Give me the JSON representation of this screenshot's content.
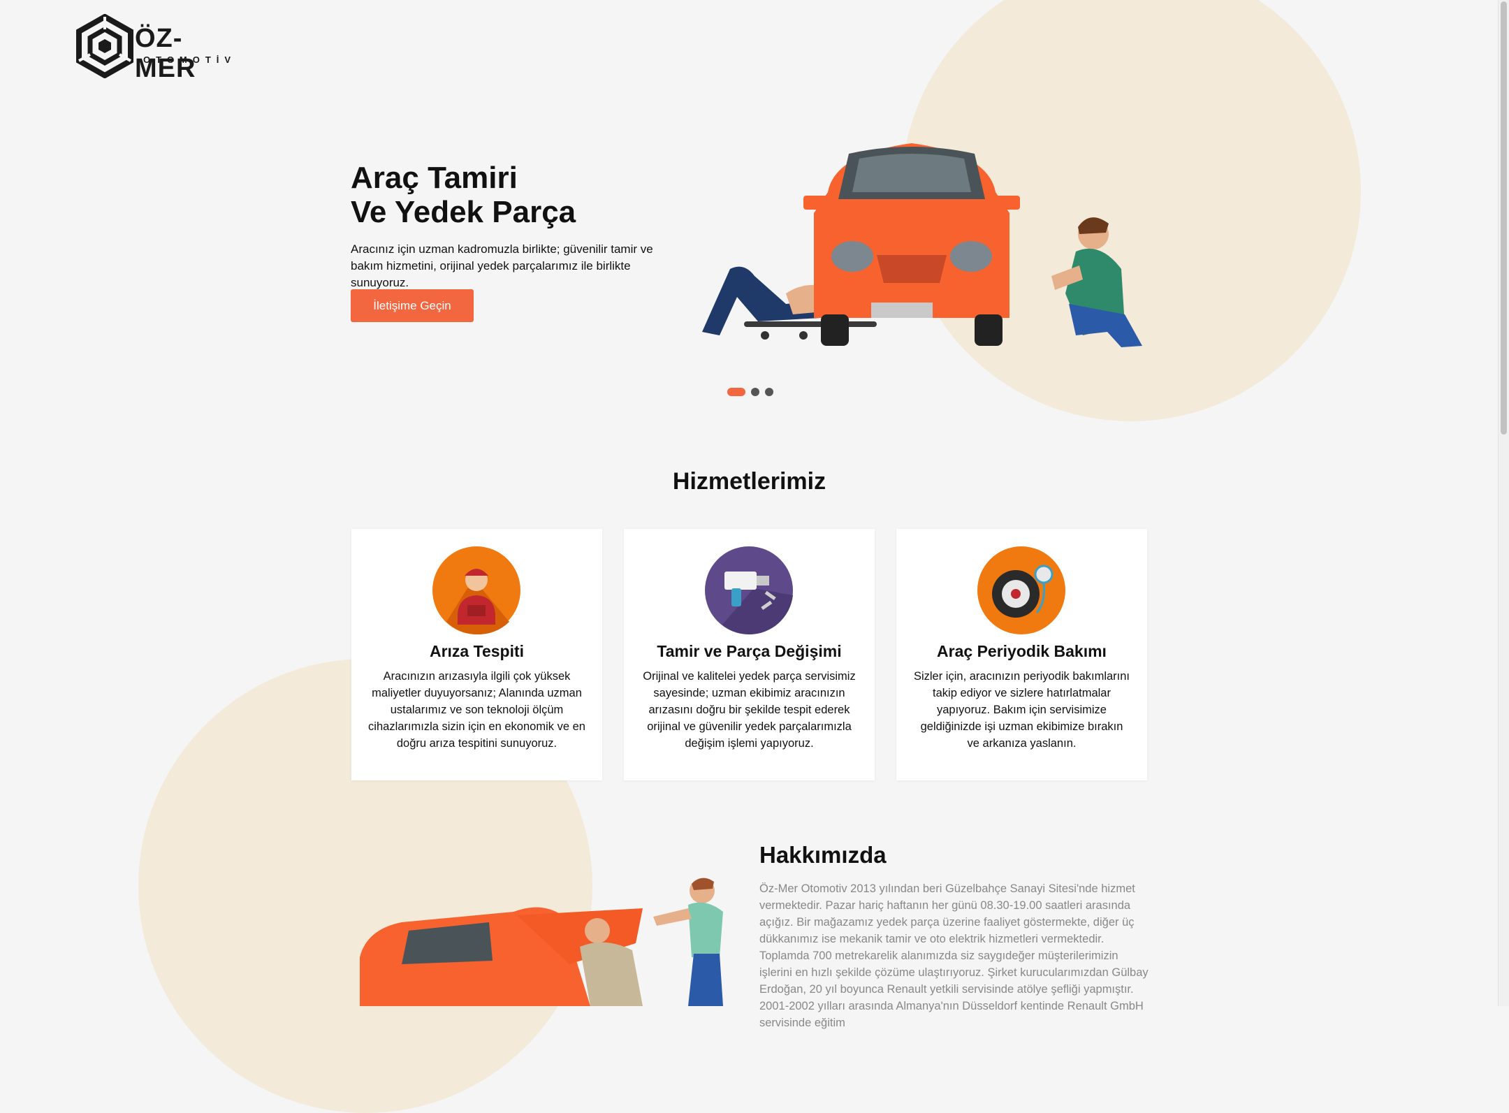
{
  "colors": {
    "accent": "#f26640",
    "blob": "#f3ead9",
    "background": "#f5f5f5"
  },
  "logo": {
    "name": "ÖZ-MER",
    "subtitle": "OTOMOTİV"
  },
  "hero": {
    "title_line1": "Araç Tamiri",
    "title_line2": "Ve Yedek Parça",
    "description": "Aracınız için uzman kadromuzla birlikte; güvenilir tamir ve bakım hizmetini, orijinal yedek parçalarımız ile birlikte sunuyoruz.",
    "cta_label": "İletişime Geçin"
  },
  "slider": {
    "slide_count": 3,
    "active_index": 1
  },
  "services": {
    "title": "Hizmetlerimiz",
    "items": [
      {
        "icon": "mechanic-icon",
        "title": "Arıza Tespiti",
        "text": "Aracınızın arızasıyla ilgili çok yüksek maliyetler duyuyorsanız; Alanında uzman ustalarımız ve son teknoloji ölçüm cihazlarımızla sizin için en ekonomik ve en doğru arıza tespitini sunuyoruz."
      },
      {
        "icon": "tools-icon",
        "title": "Tamir ve Parça Değişimi",
        "text": "Orijinal ve kalitelei yedek parça servisimiz sayesinde; uzman ekibimiz aracınızın arızasını doğru bir şekilde tespit ederek orijinal ve güvenilir yedek parçalarımızla değişim işlemi yapıyoruz."
      },
      {
        "icon": "tire-gauge-icon",
        "title": "Araç Periyodik Bakımı",
        "text": "Sizler için, aracınızın periyodik bakımlarını takip ediyor ve sizlere hatırlatmalar yapıyoruz. Bakım için servisimize geldiğinizde işi uzman ekibimize bırakın ve arkanıza yaslanın."
      }
    ]
  },
  "about": {
    "title": "Hakkımızda",
    "text": "Öz-Mer Otomotiv 2013 yılından beri Güzelbahçe Sanayi Sitesi'nde hizmet vermektedir. Pazar hariç haftanın her günü 08.30-19.00 saatleri arasında açığız. Bir mağazamız yedek parça üzerine faaliyet göstermekte, diğer üç dükkanımız ise mekanik tamir ve oto elektrik hizmetleri vermektedir. Toplamda 700 metrekarelik alanımızda siz saygıdeğer müşterilerimizin işlerini en hızlı şekilde çözüme ulaştırıyoruz. Şirket kurucularımızdan Gülbay Erdoğan, 20 yıl boyunca Renault yetkili servisinde atölye şefliği yapmıştır. 2001-2002 yılları arasında Almanya'nın Düsseldorf kentinde Renault GmbH servisinde eğitim"
  }
}
